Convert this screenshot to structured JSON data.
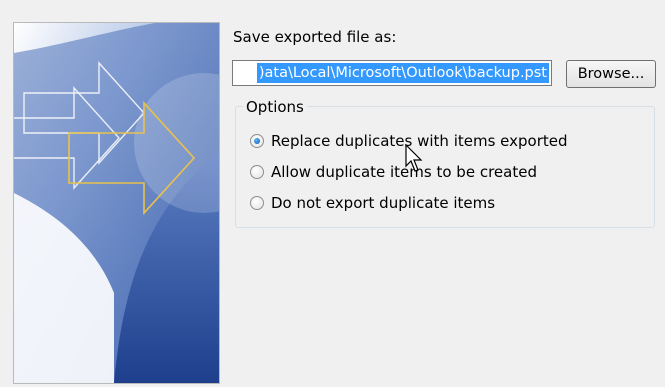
{
  "save_section": {
    "label": "Save exported file as:",
    "file_path_value": ")ata\\Local\\Microsoft\\Outlook\\backup.pst",
    "browse_label": "Browse..."
  },
  "options": {
    "legend": "Options",
    "items": [
      {
        "label": "Replace duplicates with items exported",
        "checked": true
      },
      {
        "label": "Allow duplicate items to be created",
        "checked": false
      },
      {
        "label": "Do not export duplicate items",
        "checked": false
      }
    ]
  },
  "colors": {
    "selection": "#3399ff",
    "art_blue_dark": "#2b4f9e",
    "art_arrow_gold": "#e8c24a"
  },
  "icons": {
    "pointer": "arrow-cursor-icon"
  }
}
